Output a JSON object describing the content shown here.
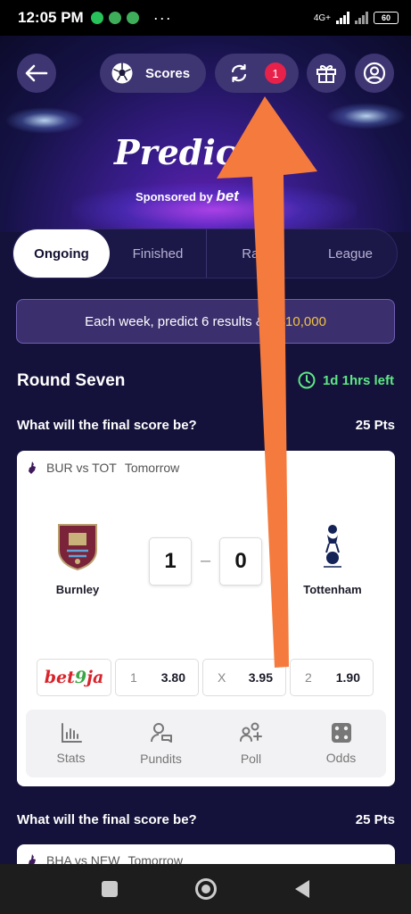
{
  "status_bar": {
    "time": "12:05 PM",
    "network": "4G+",
    "battery": "60"
  },
  "nav": {
    "scores_label": "Scores",
    "notifications_count": "1"
  },
  "hero": {
    "title": "Predic",
    "sponsor_text": "Sponsored by",
    "sponsor_brand": "bet"
  },
  "tabs": [
    {
      "label": "Ongoing",
      "active": true
    },
    {
      "label": "Finished"
    },
    {
      "label": "Ran"
    },
    {
      "label": "League"
    }
  ],
  "promo": {
    "text": "Each week, predict 6 results & ",
    "tail": "N",
    "amount": "$10,000"
  },
  "round": {
    "title": "Round Seven",
    "time_left": "1d 1hrs left"
  },
  "questions": [
    {
      "text": "What will the final score be?",
      "points": "25 Pts"
    },
    {
      "text": "What will the final score be?",
      "points": "25 Pts"
    }
  ],
  "match": {
    "header": "BUR vs TOT",
    "when": "Tomorrow",
    "home": {
      "name": "Burnley",
      "score": "1"
    },
    "away": {
      "name": "Tottenham",
      "score": "0"
    },
    "bookmaker": {
      "name_prefix": "bet",
      "name_num": "9",
      "name_suffix": "ja"
    },
    "odds": [
      {
        "key": "1",
        "value": "3.80"
      },
      {
        "key": "X",
        "value": "3.95"
      },
      {
        "key": "2",
        "value": "1.90"
      }
    ],
    "actions": [
      {
        "label": "Stats",
        "icon": "stats-icon"
      },
      {
        "label": "Pundits",
        "icon": "pundits-icon"
      },
      {
        "label": "Poll",
        "icon": "poll-icon"
      },
      {
        "label": "Odds",
        "icon": "odds-icon"
      }
    ]
  },
  "match2": {
    "header": "BHA vs NEW",
    "when": "Tomorrow"
  },
  "colors": {
    "accent_green": "#5ee884",
    "badge_red": "#e8214a",
    "promo_gold": "#f3c33e",
    "arrow_orange": "#f47b3d"
  }
}
